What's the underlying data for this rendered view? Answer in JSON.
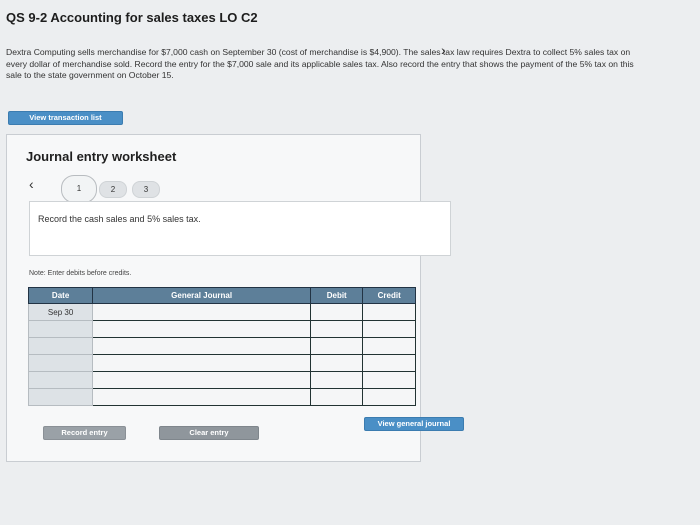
{
  "header": {
    "title": "QS 9-2 Accounting for sales taxes LO C2",
    "description": "Dextra Computing sells merchandise for $7,000 cash on September 30 (cost of merchandise is $4,900). The sales tax law requires Dextra to collect 5% sales tax on every dollar of merchandise sold. Record the entry for the $7,000 sale and its applicable sales tax. Also record the entry that shows the payment of the 5% tax on this sale to the state government on October 15."
  },
  "toolbar": {
    "view_transaction_list": "View transaction list"
  },
  "worksheet": {
    "title": "Journal entry worksheet",
    "prev_icon": "chevron-left-icon",
    "next_icon": "chevron-right-icon",
    "steps": [
      "1",
      "2",
      "3"
    ],
    "active_step": "1",
    "instruction": "Record the cash sales and 5% sales tax.",
    "note": "Note: Enter debits before credits."
  },
  "journal_table": {
    "headers": [
      "Date",
      "General Journal",
      "Debit",
      "Credit"
    ],
    "rows": [
      {
        "date": "Sep 30"
      },
      {
        "date": ""
      },
      {
        "date": ""
      },
      {
        "date": ""
      },
      {
        "date": ""
      },
      {
        "date": ""
      }
    ]
  },
  "actions": {
    "record_entry": "Record entry",
    "clear_entry": "Clear entry",
    "view_general_journal": "View general journal"
  }
}
